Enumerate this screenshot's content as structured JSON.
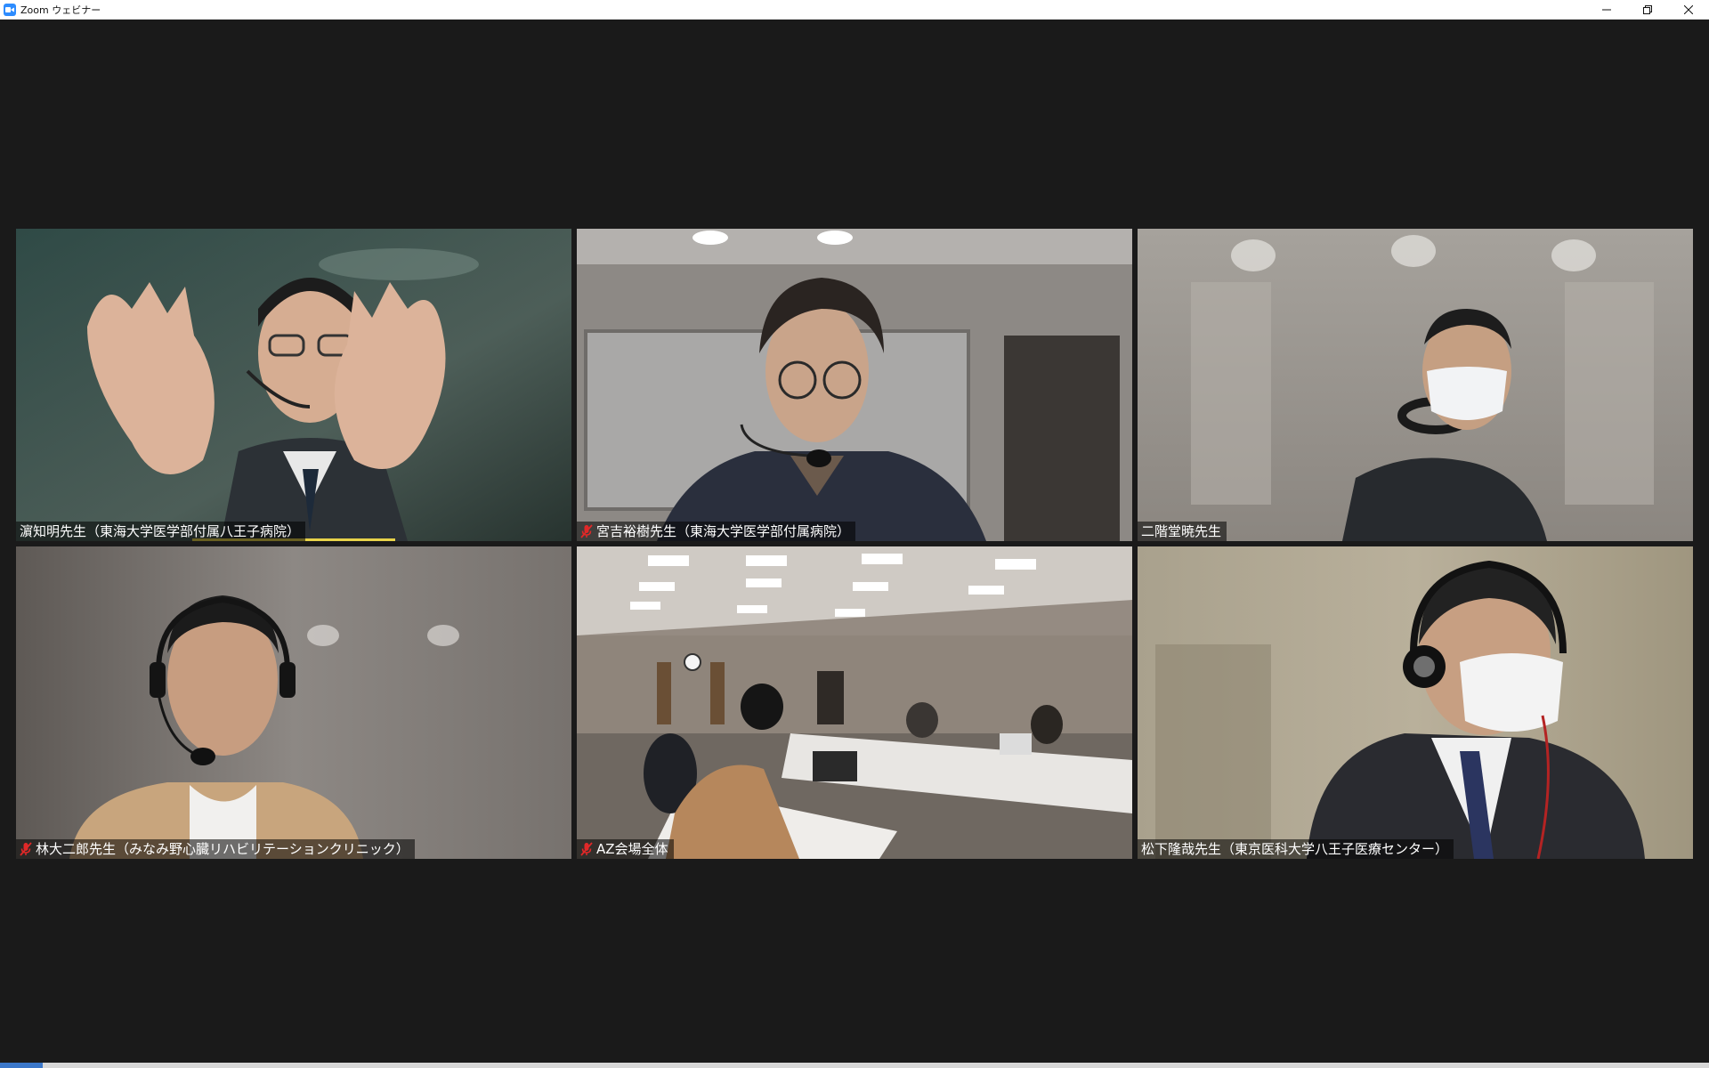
{
  "window": {
    "title": "Zoom ウェビナー",
    "icon": "zoom-camera-icon",
    "controls": [
      "minimize-icon",
      "restore-icon",
      "close-icon"
    ]
  },
  "participants": [
    {
      "name": "濵知明先生（東海大学医学部付属八王子病院）",
      "muted": false,
      "speaking": true,
      "bg": "#3a4a44"
    },
    {
      "name": "宮吉裕樹先生（東海大学医学部付属病院）",
      "muted": true,
      "speaking": false,
      "bg": "#7a7673"
    },
    {
      "name": "二階堂暁先生",
      "muted": false,
      "speaking": false,
      "bg": "#9a9590"
    },
    {
      "name": "林大二郎先生（みなみ野心臓リハビリテーションクリニック）",
      "muted": true,
      "speaking": false,
      "bg": "#6e6864"
    },
    {
      "name": "AZ会場全体",
      "muted": true,
      "speaking": false,
      "bg": "#8a8079"
    },
    {
      "name": "松下隆哉先生（東京医科大学八王子医療センター）",
      "muted": false,
      "speaking": false,
      "bg": "#a89f8c"
    }
  ],
  "colors": {
    "mute_red": "#e02828",
    "speaker_highlight": "#e7d24a",
    "zoom_blue": "#2d8cff"
  }
}
